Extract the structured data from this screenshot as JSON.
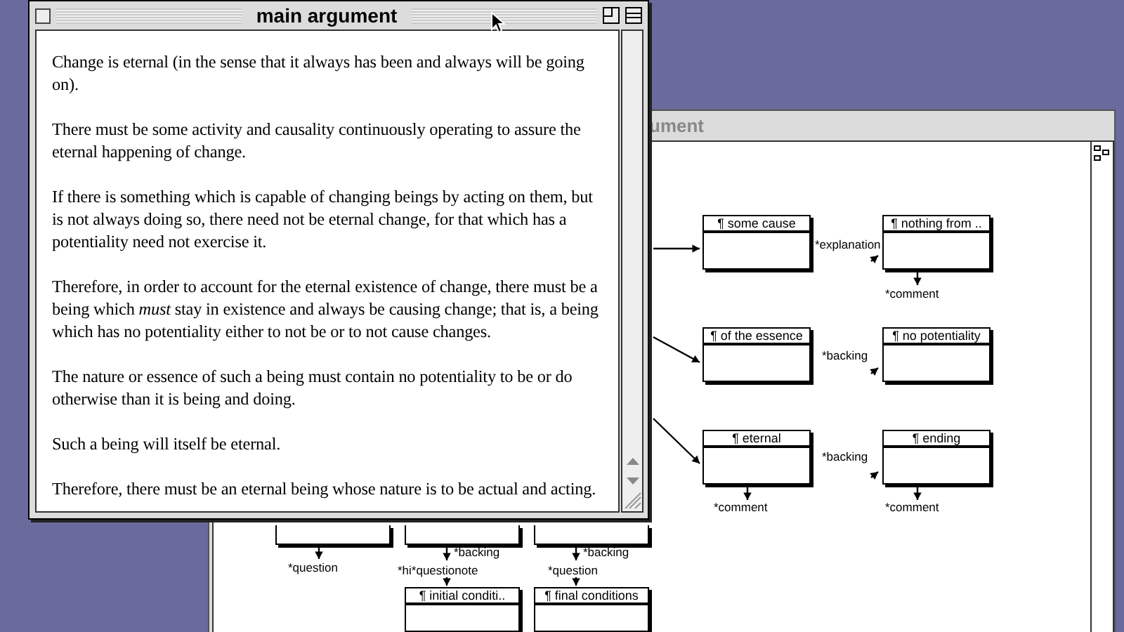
{
  "back_window": {
    "title": "ument",
    "nodes": [
      {
        "title": "¶ some cause"
      },
      {
        "title": "¶ nothing from .."
      },
      {
        "title": "¶ of the essence"
      },
      {
        "title": "¶ no potentiality"
      },
      {
        "title": "¶ eternal"
      },
      {
        "title": "¶ ending"
      },
      {
        "kind": "partial"
      },
      {
        "kind": "partial"
      },
      {
        "kind": "partial"
      },
      {
        "title": "¶ initial conditi.."
      },
      {
        "title": "¶ final conditions"
      }
    ],
    "labels": [
      "*explanation",
      "*comment",
      "*backing",
      "*backing",
      "*comment",
      "*comment",
      "*question",
      "*backing",
      "*hi*questionote",
      "*backing",
      "*question"
    ]
  },
  "front_window": {
    "title": "main argument",
    "paragraphs": [
      "Change is eternal (in the sense that it always has been and always will be going on).",
      "There must be some activity and causality continuously operating to assure the eternal happening of change.",
      "If there is something which is capable of changing beings by acting on them, but is not  always doing so, there need not be eternal change, for that which has a potentiality need not exercise it.",
      "Therefore, in order to account for the eternal existence of change, there must be a being which *must* stay in existence and always be causing change; that is, a being which has no potentiality either to not be or to not cause changes.",
      "The nature or essence of such a being must contain no potentiality to be or do otherwise than it is being and doing.",
      "Such a being will itself be eternal.",
      "Therefore, there must be an eternal being whose nature is to be actual and acting."
    ]
  }
}
